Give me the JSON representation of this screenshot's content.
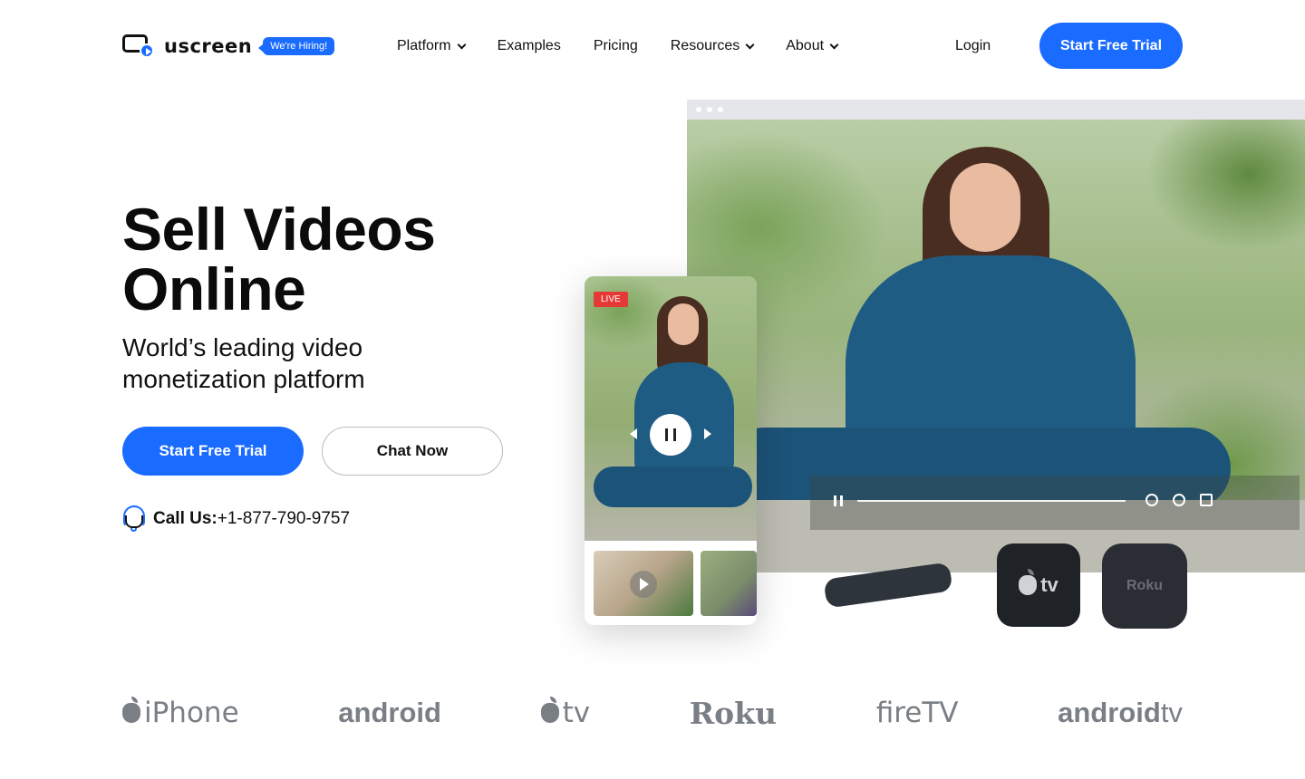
{
  "brand": {
    "name": "uscreen",
    "hiring_badge": "We're Hiring!",
    "accent_color": "#1a6bff"
  },
  "nav": {
    "items": [
      {
        "label": "Platform",
        "has_dropdown": true
      },
      {
        "label": "Examples",
        "has_dropdown": false
      },
      {
        "label": "Pricing",
        "has_dropdown": false
      },
      {
        "label": "Resources",
        "has_dropdown": true
      },
      {
        "label": "About",
        "has_dropdown": true
      }
    ],
    "login": "Login",
    "cta": "Start Free Trial"
  },
  "hero": {
    "title_line1": "Sell Videos",
    "title_line2": "Online",
    "subtitle": "World’s leading video monetization platform",
    "primary_button": "Start Free Trial",
    "secondary_button": "Chat Now",
    "call_label": "Call Us:",
    "call_number": "+1-877-790-9757"
  },
  "visual": {
    "live_badge": "LIVE",
    "apple_tv_label": "tv",
    "roku_label": "Roku",
    "icons": [
      "pause-icon",
      "settings-icon",
      "volume-icon",
      "fullscreen-icon",
      "skip-back-icon",
      "skip-forward-icon",
      "play-icon"
    ]
  },
  "platforms": {
    "iphone": "iPhone",
    "android": "android",
    "appletv": "tv",
    "roku": "Roku",
    "firetv": "fireTV",
    "androidtv_bold": "android",
    "androidtv_light": "tv"
  }
}
